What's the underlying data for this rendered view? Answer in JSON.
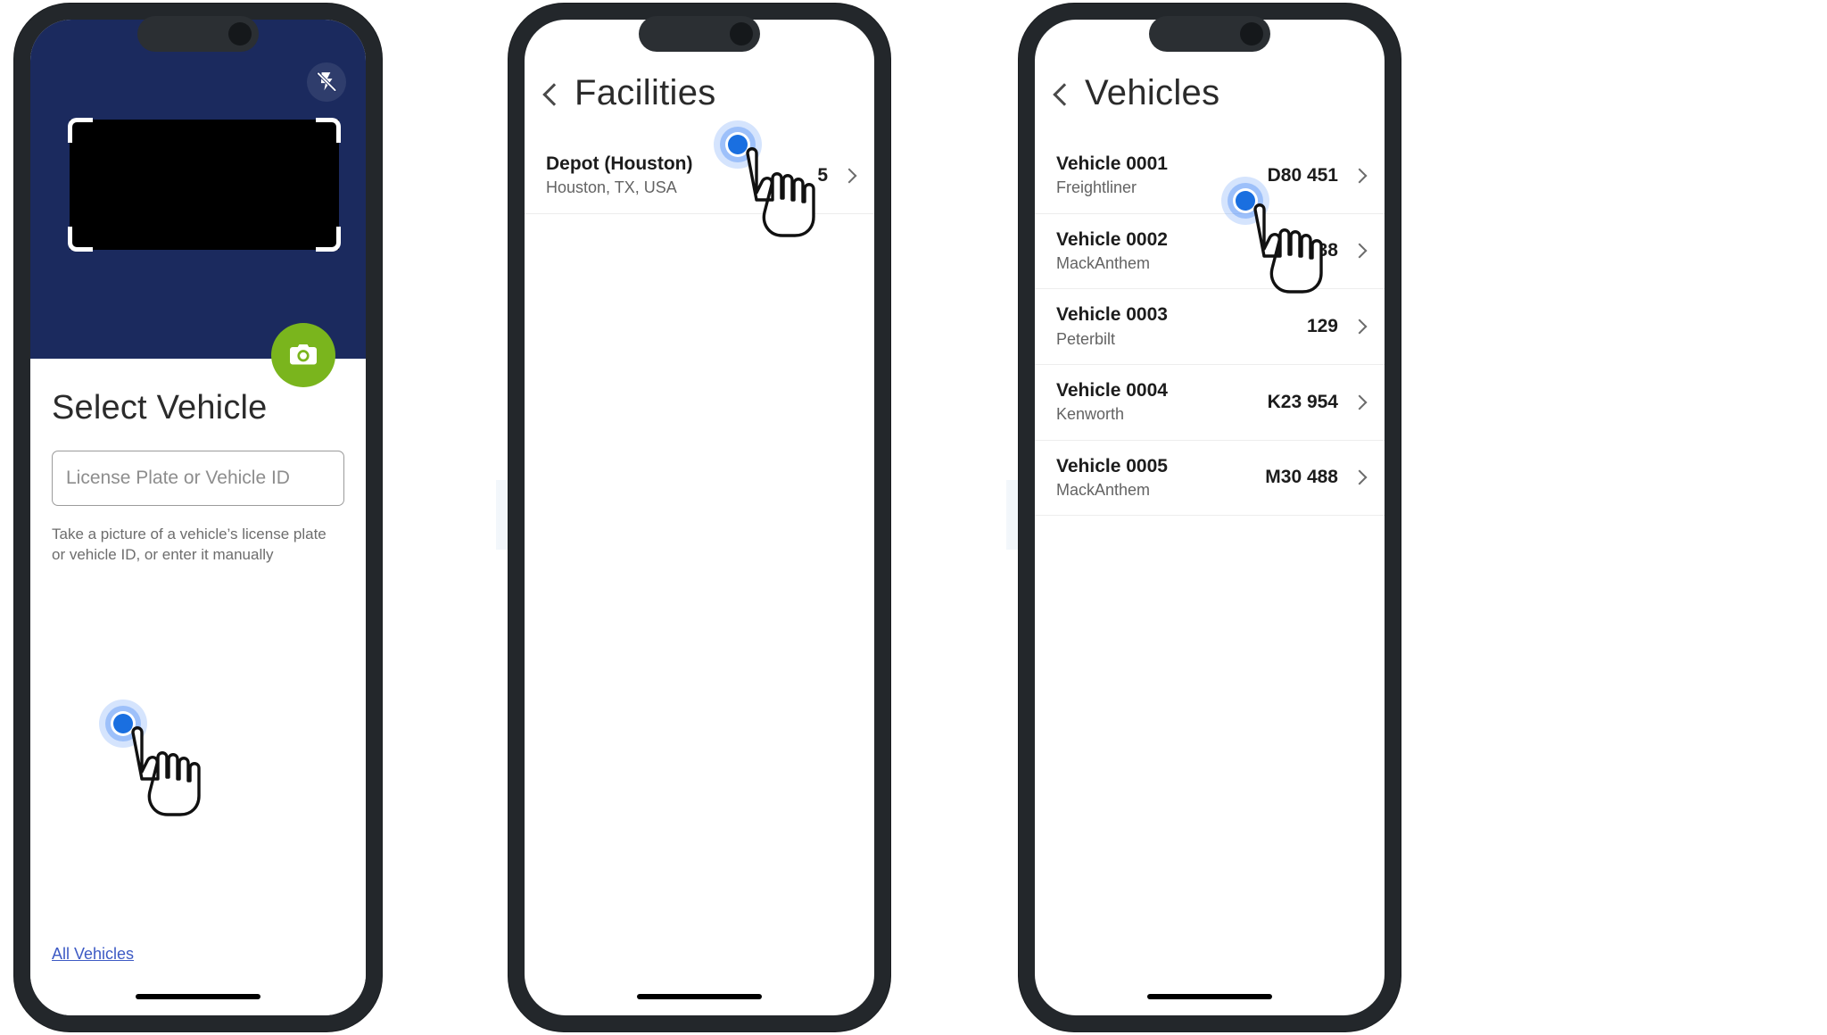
{
  "colors": {
    "camera_bg": "#1b2a5e",
    "camera_button": "#7ab51d",
    "link": "#3d5ac4",
    "tap_dot": "#1a6fe0",
    "arrow": "#dbe3ec",
    "phone_frame": "#23272b"
  },
  "screens": [
    {
      "id": "scanner",
      "icons": {
        "flash": "flash-off-icon",
        "camera": "camera-icon"
      },
      "scan_frame": "license-plate-scan-frame",
      "heading": "Select Vehicle",
      "input": {
        "value": "",
        "placeholder": "License Plate or Vehicle ID"
      },
      "hint_line1": "Take a picture of a vehicle’s license plate",
      "hint_line2": "or vehicle ID, or enter it manually",
      "all_vehicles_link": "All Vehicles",
      "tap_target": "all-vehicles-link"
    },
    {
      "id": "facilities",
      "back_icon": "chevron-left-icon",
      "title": "Facilities",
      "rows": [
        {
          "name": "Depot (Houston)",
          "sub": "Houston, TX, USA",
          "meta": "5"
        }
      ],
      "tap_target": "facility-row-depot-houston"
    },
    {
      "id": "vehicles",
      "back_icon": "chevron-left-icon",
      "title": "Vehicles",
      "rows": [
        {
          "name": "Vehicle 0001",
          "sub": "Freightliner",
          "meta": "D80 451"
        },
        {
          "name": "Vehicle 0002",
          "sub": "MackAnthem",
          "meta": "N98 238"
        },
        {
          "name": "Vehicle 0003",
          "sub": "Peterbilt",
          "meta": "129"
        },
        {
          "name": "Vehicle 0004",
          "sub": "Kenworth",
          "meta": "K23 954"
        },
        {
          "name": "Vehicle 0005",
          "sub": "MackAnthem",
          "meta": "M30 488"
        }
      ],
      "tap_target": "vehicle-row-0002"
    }
  ],
  "flow": {
    "arrow1": "step-arrow-right",
    "arrow2": "step-arrow-right"
  }
}
